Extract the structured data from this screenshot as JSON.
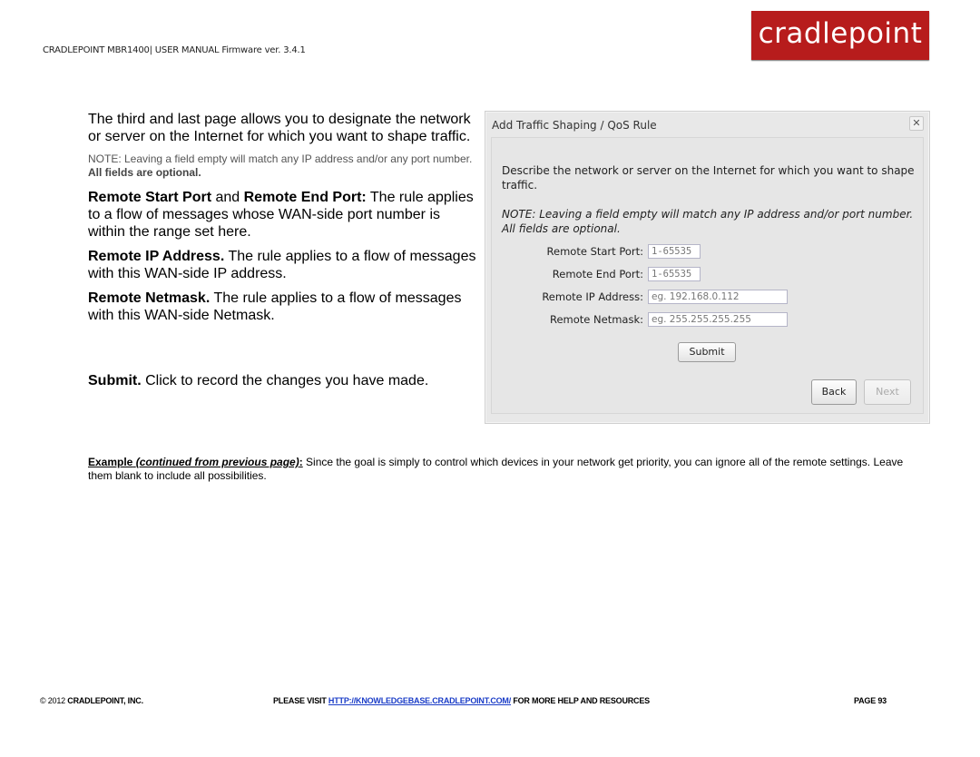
{
  "header": {
    "manual_title": "CRADLEPOINT MBR1400| USER MANUAL Firmware ver. 3.4.1",
    "logo_text": "cradlepoint",
    "logo_color": "#b71c1c"
  },
  "body": {
    "intro": "The third and last page allows you to designate the network or server on the Internet for which you want to shape traffic.",
    "note_prefix": "NOTE: Leaving a field empty will match any IP address and/or any port number.",
    "note_bold": "All fields are optional.",
    "ports": {
      "bold1": "Remote Start Port",
      "and": " and ",
      "bold2": "Remote End Port:",
      "text": " The rule applies to a flow of messages whose WAN-side port number is within the range set here."
    },
    "ip": {
      "bold": "Remote IP Address.",
      "text": " The rule applies to a flow of messages with this WAN-side IP address."
    },
    "netmask": {
      "bold": "Remote Netmask.",
      "text": " The rule applies to a flow of messages with this WAN-side Netmask."
    },
    "submit": {
      "bold": "Submit.",
      "text": " Click to record the changes you have made."
    }
  },
  "dialog": {
    "title": "Add Traffic Shaping / QoS Rule",
    "close_glyph": "✕",
    "description": "Describe the network or server on the Internet for which you want to shape traffic.",
    "note": "NOTE: Leaving a field empty will match any IP address and/or port number. All fields are optional.",
    "fields": [
      {
        "label": "Remote Start Port:",
        "placeholder": "1-65535"
      },
      {
        "label": "Remote End Port:",
        "placeholder": "1-65535"
      },
      {
        "label": "Remote IP Address:",
        "placeholder": "eg. 192.168.0.112"
      },
      {
        "label": "Remote Netmask:",
        "placeholder": "eg. 255.255.255.255"
      }
    ],
    "submit_label": "Submit",
    "back_label": "Back",
    "next_label": "Next"
  },
  "example": {
    "label": "Example",
    "italic": "(continued from previous page)",
    "colon": ":",
    "text": " Since the goal is simply to control which devices in your network get priority, you can ignore all of the remote settings. Leave them blank to include all possibilities."
  },
  "footer": {
    "copyright_year": "© 2012",
    "company": "CRADLEPOINT, INC.",
    "visit_prefix": "PLEASE VISIT ",
    "link": "HTTP://KNOWLEDGEBASE.CRADLEPOINT.COM/",
    "visit_suffix": " FOR MORE HELP AND RESOURCES",
    "page": "PAGE 93"
  }
}
